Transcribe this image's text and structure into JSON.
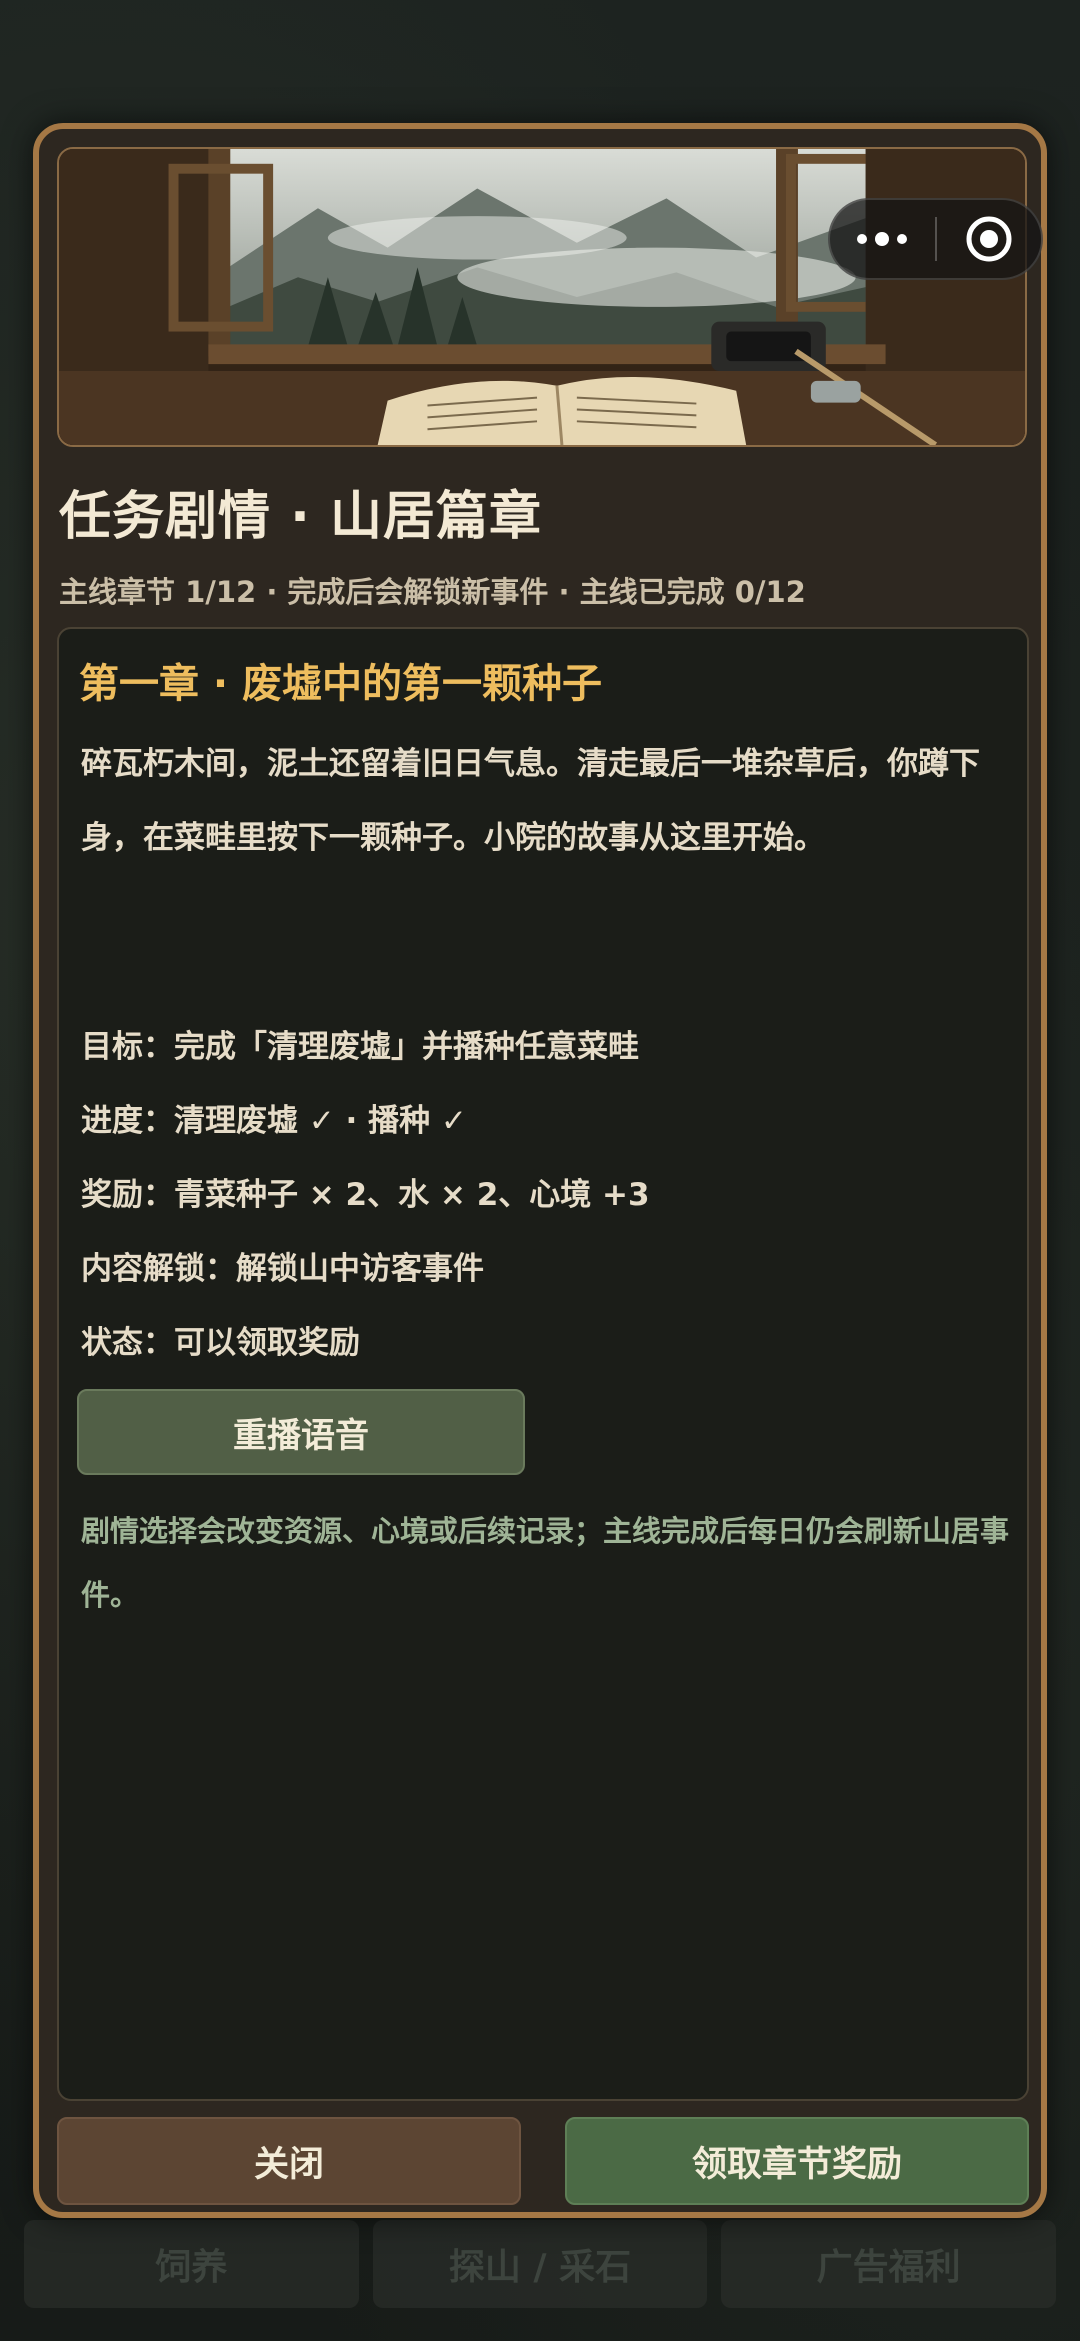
{
  "bottom_nav": {
    "items": [
      {
        "label": "饲养"
      },
      {
        "label": "探山 / 采石"
      },
      {
        "label": "广告福利"
      }
    ]
  },
  "capsule": {
    "more_icon": "more-dots-icon",
    "close_icon": "target-circle-icon"
  },
  "modal": {
    "title": "任务剧情 · 山居篇章",
    "subtitle": "主线章节 1/12 · 完成后会解锁新事件 · 主线已完成 0/12",
    "chapter_title": "第一章 · 废墟中的第一颗种子",
    "story": "碎瓦朽木间，泥土还留着旧日气息。清走最后一堆杂草后，你蹲下身，在菜畦里按下一颗种子。小院的故事从这里开始。",
    "goal": "目标：完成「清理废墟」并播种任意菜畦",
    "progress": "进度：清理废墟 ✓ · 播种 ✓",
    "reward": "奖励：青菜种子 × 2、水 × 2、心境 +3",
    "unlock": "内容解锁：解锁山中访客事件",
    "status": "状态：可以领取奖励",
    "replay_label": "重播语音",
    "hint": "剧情选择会改变资源、心境或后续记录；主线完成后每日仍会刷新山居事件。",
    "close_label": "关闭",
    "claim_label": "领取章节奖励"
  },
  "colors": {
    "border": "#a57845",
    "chapter_title": "#eebd5e",
    "hint": "#9fb496",
    "claim_button": "#4b6a45",
    "close_button": "#5c4533"
  }
}
